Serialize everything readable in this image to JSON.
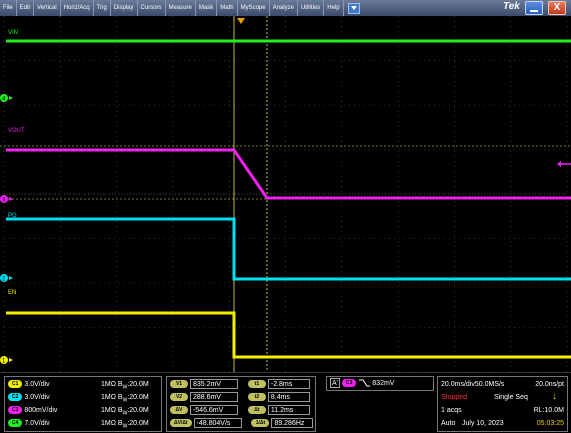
{
  "menu": {
    "items": [
      "File",
      "Edit",
      "Vertical",
      "Horiz/Acq",
      "Trig",
      "Display",
      "Cursors",
      "Measure",
      "Mask",
      "Math",
      "MyScope",
      "Analyze",
      "Utilities",
      "Help"
    ],
    "brand": "Tek",
    "close_label": "X"
  },
  "traces": {
    "vin_label": "VIN",
    "vout_label": "VOUT",
    "pg_label": "PG",
    "en_label": "EN",
    "marker_vin": "4",
    "marker_vout": "3",
    "marker_pg": "2",
    "marker_en": "1"
  },
  "colors": {
    "ch1": "#f0f000",
    "ch2": "#00e0f0",
    "ch3": "#f020f0",
    "ch4": "#20f020",
    "background": "#000000",
    "grid": "#555555"
  },
  "channels": [
    {
      "badge": "C1",
      "scale": "3.0V/div",
      "coupling": "1MΩ",
      "bw": "B",
      "bw_sub": "W",
      "bw_val": ":20.0M",
      "color": "#f0f000"
    },
    {
      "badge": "C2",
      "scale": "3.0V/div",
      "coupling": "1MΩ",
      "bw": "B",
      "bw_sub": "W",
      "bw_val": ":20.0M",
      "color": "#00e0f0"
    },
    {
      "badge": "C3",
      "scale": "800mV/div",
      "coupling": "1MΩ",
      "bw": "B",
      "bw_sub": "W",
      "bw_val": ":20.0M",
      "color": "#f020f0"
    },
    {
      "badge": "C4",
      "scale": "7.0V/div",
      "coupling": "1MΩ",
      "bw": "B",
      "bw_sub": "W",
      "bw_val": ":20.0M",
      "color": "#20f020"
    }
  ],
  "cursors_v": [
    {
      "label": "V1",
      "value": "835.2mV"
    },
    {
      "label": "V2",
      "value": "288.6mV"
    },
    {
      "label": "ΔV",
      "value": "-546.6mV"
    },
    {
      "label": "ΔV/Δt",
      "value": "-48.804V/s"
    }
  ],
  "cursors_t": [
    {
      "label": "t1",
      "value": "-2.8ms"
    },
    {
      "label": "t2",
      "value": "8.4ms"
    },
    {
      "label": "Δt",
      "value": "11.2ms"
    },
    {
      "label": "1/Δt",
      "value": "89.286Hz"
    }
  ],
  "trigger": {
    "source_label": "A'",
    "channel": "C3",
    "level": "832mV"
  },
  "acquisition": {
    "timebase": "20.0ms/div",
    "sample_rate": "50.0MS/s",
    "resolution": "20.0ns/pt",
    "state": "Stopped",
    "mode": "Single Seq",
    "acqs": "1 acqs",
    "record_length": "RL:10.0M",
    "trigger_mode": "Auto",
    "date": "July 10, 2023",
    "time": "05:03:25"
  }
}
